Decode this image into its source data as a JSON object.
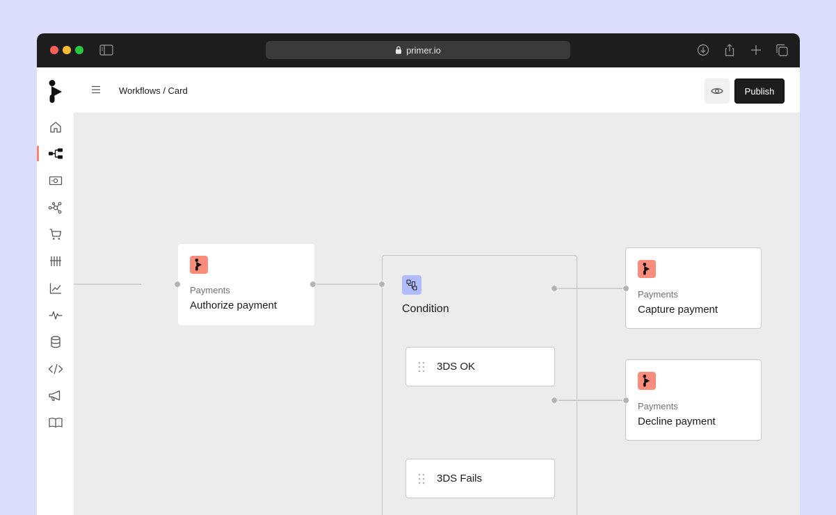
{
  "browser": {
    "url": "primer.io"
  },
  "header": {
    "breadcrumb": "Workflows / Card",
    "publish_label": "Publish"
  },
  "sidebar": {
    "items": [
      {
        "icon": "home-icon"
      },
      {
        "icon": "workflow-icon",
        "active": true
      },
      {
        "icon": "money-icon"
      },
      {
        "icon": "connections-icon"
      },
      {
        "icon": "cart-icon"
      },
      {
        "icon": "tally-icon"
      },
      {
        "icon": "chart-icon"
      },
      {
        "icon": "pulse-icon"
      },
      {
        "icon": "database-icon"
      },
      {
        "icon": "code-icon"
      },
      {
        "icon": "megaphone-icon"
      },
      {
        "icon": "book-icon"
      }
    ]
  },
  "workflow": {
    "authorize": {
      "category": "Payments",
      "title": "Authorize payment"
    },
    "condition": {
      "title": "Condition",
      "branches": [
        {
          "label": "3DS OK"
        },
        {
          "label": "3DS Fails"
        }
      ]
    },
    "capture": {
      "category": "Payments",
      "title": "Capture payment"
    },
    "decline": {
      "category": "Payments",
      "title": "Decline payment"
    }
  },
  "colors": {
    "background": "#dcdcfc",
    "canvas": "#ececec",
    "payments_badge": "#f98c7b",
    "condition_badge": "#b2bbfb",
    "active_nav": "#f5866f",
    "primary_button": "#1d1d1d"
  }
}
